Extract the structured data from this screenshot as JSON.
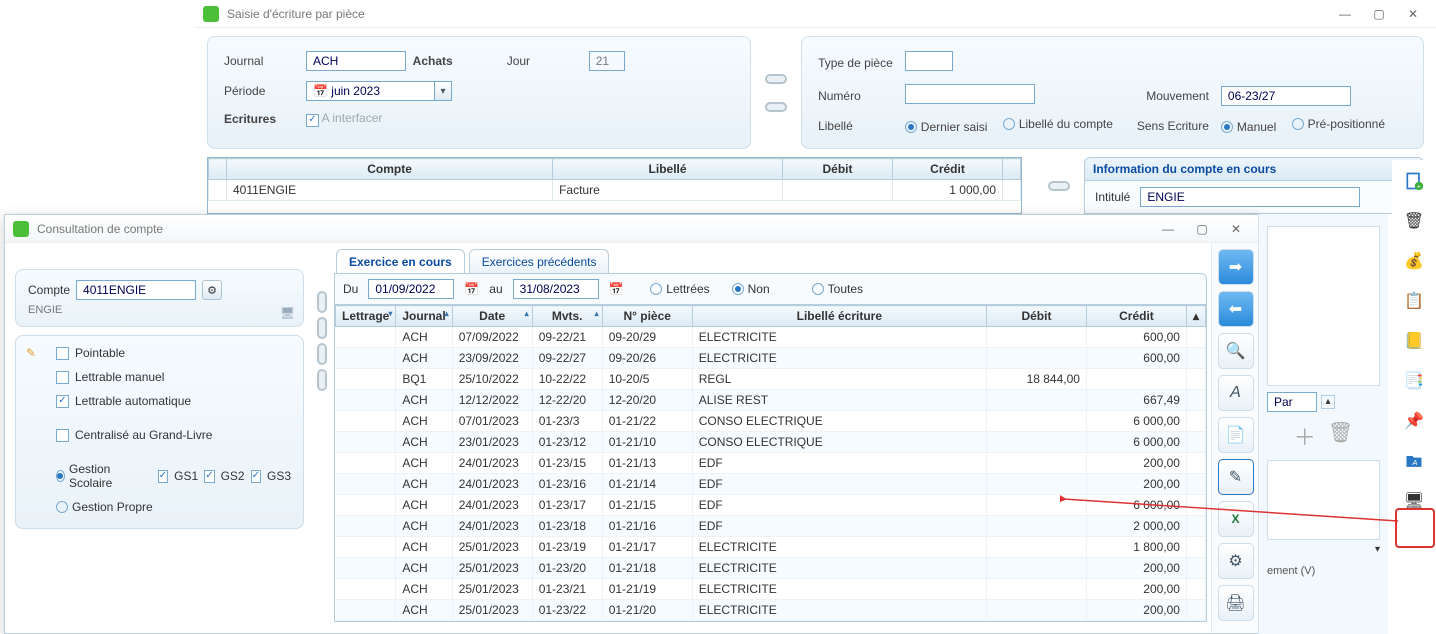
{
  "main": {
    "title": "Saisie d'écriture par pièce",
    "labels": {
      "journal": "Journal",
      "periode": "Période",
      "ecritures": "Ecritures",
      "jour": "Jour",
      "type_piece": "Type de pièce",
      "numero": "Numéro",
      "mouvement": "Mouvement",
      "libelle": "Libellé",
      "sens": "Sens Ecriture",
      "a_interfacer": "A interfacer"
    },
    "journal_code": "ACH",
    "journal_name": "Achats",
    "periode": "juin 2023",
    "jour": "21",
    "mouvement": "06-23/27",
    "radios": {
      "libelle": {
        "dernier_saisi": "Dernier saisi",
        "libelle_du_compte": "Libellé du compte",
        "selected": "dernier_saisi"
      },
      "sens": {
        "manuel": "Manuel",
        "pre": "Pré-positionné",
        "selected": "manuel"
      }
    },
    "grid": {
      "headers": {
        "compte": "Compte",
        "libelle": "Libellé",
        "debit": "Débit",
        "credit": "Crédit"
      },
      "rows": [
        {
          "compte": "4011ENGIE",
          "libelle": "Facture",
          "debit": "",
          "credit": "1 000,00"
        }
      ]
    },
    "info": {
      "title": "Information du compte en cours",
      "intitule_label": "Intitulé",
      "intitule": "ENGIE"
    }
  },
  "sub": {
    "title": "Consultation de compte",
    "compte_label": "Compte",
    "compte": "4011ENGIE",
    "compte_name": "ENGIE",
    "tabs": {
      "current": "Exercice en cours",
      "prev": "Exercices précédents"
    },
    "filter": {
      "du": "Du",
      "du_val": "01/09/2022",
      "au": "au",
      "au_val": "31/08/2023",
      "lettrees": "Lettrées",
      "non": "Non",
      "toutes": "Toutes",
      "selected": "non"
    },
    "options": {
      "pointable": "Pointable",
      "lettrable_manuel": "Lettrable manuel",
      "lettrable_auto": "Lettrable automatique",
      "centralise": "Centralisé au Grand-Livre",
      "gestion_scolaire": "Gestion Scolaire",
      "gestion_propre": "Gestion Propre",
      "gs1": "GS1",
      "gs2": "GS2",
      "gs3": "GS3"
    },
    "ledger": {
      "headers": {
        "lettrage": "Lettrage",
        "journal": "Journal",
        "date": "Date",
        "mvts": "Mvts.",
        "piece": "N° pièce",
        "lib": "Libellé écriture",
        "debit": "Débit",
        "credit": "Crédit"
      },
      "rows": [
        {
          "j": "ACH",
          "d": "07/09/2022",
          "m": "09-22/21",
          "p": "09-20/29",
          "l": "ELECTRICITE",
          "db": "",
          "cr": "600,00"
        },
        {
          "j": "ACH",
          "d": "23/09/2022",
          "m": "09-22/27",
          "p": "09-20/26",
          "l": "ELECTRICITE",
          "db": "",
          "cr": "600,00"
        },
        {
          "j": "BQ1",
          "d": "25/10/2022",
          "m": "10-22/22",
          "p": "10-20/5",
          "l": "REGL",
          "db": "18 844,00",
          "cr": ""
        },
        {
          "j": "ACH",
          "d": "12/12/2022",
          "m": "12-22/20",
          "p": "12-20/20",
          "l": "ALISE REST",
          "db": "",
          "cr": "667,49"
        },
        {
          "j": "ACH",
          "d": "07/01/2023",
          "m": "01-23/3",
          "p": "01-21/22",
          "l": "CONSO ELECTRIQUE",
          "db": "",
          "cr": "6 000,00"
        },
        {
          "j": "ACH",
          "d": "23/01/2023",
          "m": "01-23/12",
          "p": "01-21/10",
          "l": "CONSO ELECTRIQUE",
          "db": "",
          "cr": "6 000,00"
        },
        {
          "j": "ACH",
          "d": "24/01/2023",
          "m": "01-23/15",
          "p": "01-21/13",
          "l": "EDF",
          "db": "",
          "cr": "200,00"
        },
        {
          "j": "ACH",
          "d": "24/01/2023",
          "m": "01-23/16",
          "p": "01-21/14",
          "l": "EDF",
          "db": "",
          "cr": "200,00"
        },
        {
          "j": "ACH",
          "d": "24/01/2023",
          "m": "01-23/17",
          "p": "01-21/15",
          "l": "EDF",
          "db": "",
          "cr": "6 000,00"
        },
        {
          "j": "ACH",
          "d": "24/01/2023",
          "m": "01-23/18",
          "p": "01-21/16",
          "l": "EDF",
          "db": "",
          "cr": "2 000,00"
        },
        {
          "j": "ACH",
          "d": "25/01/2023",
          "m": "01-23/19",
          "p": "01-21/17",
          "l": "ELECTRICITE",
          "db": "",
          "cr": "1 800,00"
        },
        {
          "j": "ACH",
          "d": "25/01/2023",
          "m": "01-23/20",
          "p": "01-21/18",
          "l": "ELECTRICITE",
          "db": "",
          "cr": "200,00"
        },
        {
          "j": "ACH",
          "d": "25/01/2023",
          "m": "01-23/21",
          "p": "01-21/19",
          "l": "ELECTRICITE",
          "db": "",
          "cr": "200,00"
        },
        {
          "j": "ACH",
          "d": "25/01/2023",
          "m": "01-23/22",
          "p": "01-21/20",
          "l": "ELECTRICITE",
          "db": "",
          "cr": "200,00"
        }
      ]
    },
    "right_stub": {
      "par": "Par",
      "ement": "ement (V)"
    }
  }
}
